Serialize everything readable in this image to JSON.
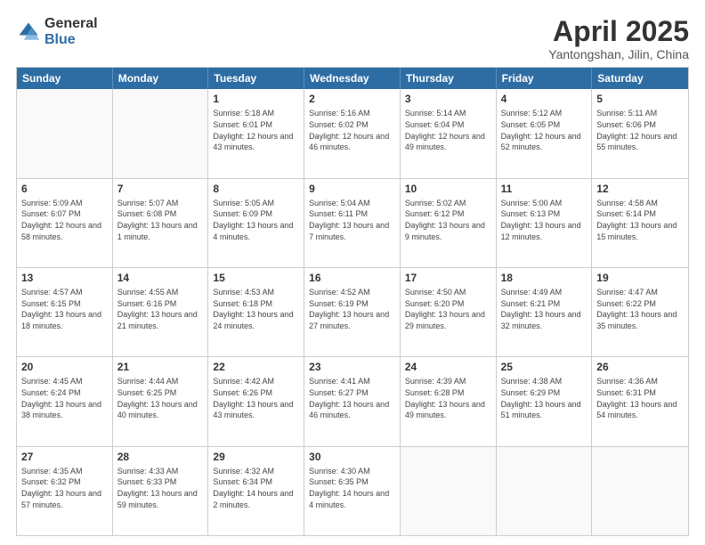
{
  "logo": {
    "general": "General",
    "blue": "Blue"
  },
  "title": "April 2025",
  "subtitle": "Yantongshan, Jilin, China",
  "header_days": [
    "Sunday",
    "Monday",
    "Tuesday",
    "Wednesday",
    "Thursday",
    "Friday",
    "Saturday"
  ],
  "weeks": [
    [
      {
        "day": "",
        "info": ""
      },
      {
        "day": "",
        "info": ""
      },
      {
        "day": "1",
        "info": "Sunrise: 5:18 AM\nSunset: 6:01 PM\nDaylight: 12 hours and 43 minutes."
      },
      {
        "day": "2",
        "info": "Sunrise: 5:16 AM\nSunset: 6:02 PM\nDaylight: 12 hours and 46 minutes."
      },
      {
        "day": "3",
        "info": "Sunrise: 5:14 AM\nSunset: 6:04 PM\nDaylight: 12 hours and 49 minutes."
      },
      {
        "day": "4",
        "info": "Sunrise: 5:12 AM\nSunset: 6:05 PM\nDaylight: 12 hours and 52 minutes."
      },
      {
        "day": "5",
        "info": "Sunrise: 5:11 AM\nSunset: 6:06 PM\nDaylight: 12 hours and 55 minutes."
      }
    ],
    [
      {
        "day": "6",
        "info": "Sunrise: 5:09 AM\nSunset: 6:07 PM\nDaylight: 12 hours and 58 minutes."
      },
      {
        "day": "7",
        "info": "Sunrise: 5:07 AM\nSunset: 6:08 PM\nDaylight: 13 hours and 1 minute."
      },
      {
        "day": "8",
        "info": "Sunrise: 5:05 AM\nSunset: 6:09 PM\nDaylight: 13 hours and 4 minutes."
      },
      {
        "day": "9",
        "info": "Sunrise: 5:04 AM\nSunset: 6:11 PM\nDaylight: 13 hours and 7 minutes."
      },
      {
        "day": "10",
        "info": "Sunrise: 5:02 AM\nSunset: 6:12 PM\nDaylight: 13 hours and 9 minutes."
      },
      {
        "day": "11",
        "info": "Sunrise: 5:00 AM\nSunset: 6:13 PM\nDaylight: 13 hours and 12 minutes."
      },
      {
        "day": "12",
        "info": "Sunrise: 4:58 AM\nSunset: 6:14 PM\nDaylight: 13 hours and 15 minutes."
      }
    ],
    [
      {
        "day": "13",
        "info": "Sunrise: 4:57 AM\nSunset: 6:15 PM\nDaylight: 13 hours and 18 minutes."
      },
      {
        "day": "14",
        "info": "Sunrise: 4:55 AM\nSunset: 6:16 PM\nDaylight: 13 hours and 21 minutes."
      },
      {
        "day": "15",
        "info": "Sunrise: 4:53 AM\nSunset: 6:18 PM\nDaylight: 13 hours and 24 minutes."
      },
      {
        "day": "16",
        "info": "Sunrise: 4:52 AM\nSunset: 6:19 PM\nDaylight: 13 hours and 27 minutes."
      },
      {
        "day": "17",
        "info": "Sunrise: 4:50 AM\nSunset: 6:20 PM\nDaylight: 13 hours and 29 minutes."
      },
      {
        "day": "18",
        "info": "Sunrise: 4:49 AM\nSunset: 6:21 PM\nDaylight: 13 hours and 32 minutes."
      },
      {
        "day": "19",
        "info": "Sunrise: 4:47 AM\nSunset: 6:22 PM\nDaylight: 13 hours and 35 minutes."
      }
    ],
    [
      {
        "day": "20",
        "info": "Sunrise: 4:45 AM\nSunset: 6:24 PM\nDaylight: 13 hours and 38 minutes."
      },
      {
        "day": "21",
        "info": "Sunrise: 4:44 AM\nSunset: 6:25 PM\nDaylight: 13 hours and 40 minutes."
      },
      {
        "day": "22",
        "info": "Sunrise: 4:42 AM\nSunset: 6:26 PM\nDaylight: 13 hours and 43 minutes."
      },
      {
        "day": "23",
        "info": "Sunrise: 4:41 AM\nSunset: 6:27 PM\nDaylight: 13 hours and 46 minutes."
      },
      {
        "day": "24",
        "info": "Sunrise: 4:39 AM\nSunset: 6:28 PM\nDaylight: 13 hours and 49 minutes."
      },
      {
        "day": "25",
        "info": "Sunrise: 4:38 AM\nSunset: 6:29 PM\nDaylight: 13 hours and 51 minutes."
      },
      {
        "day": "26",
        "info": "Sunrise: 4:36 AM\nSunset: 6:31 PM\nDaylight: 13 hours and 54 minutes."
      }
    ],
    [
      {
        "day": "27",
        "info": "Sunrise: 4:35 AM\nSunset: 6:32 PM\nDaylight: 13 hours and 57 minutes."
      },
      {
        "day": "28",
        "info": "Sunrise: 4:33 AM\nSunset: 6:33 PM\nDaylight: 13 hours and 59 minutes."
      },
      {
        "day": "29",
        "info": "Sunrise: 4:32 AM\nSunset: 6:34 PM\nDaylight: 14 hours and 2 minutes."
      },
      {
        "day": "30",
        "info": "Sunrise: 4:30 AM\nSunset: 6:35 PM\nDaylight: 14 hours and 4 minutes."
      },
      {
        "day": "",
        "info": ""
      },
      {
        "day": "",
        "info": ""
      },
      {
        "day": "",
        "info": ""
      }
    ]
  ]
}
